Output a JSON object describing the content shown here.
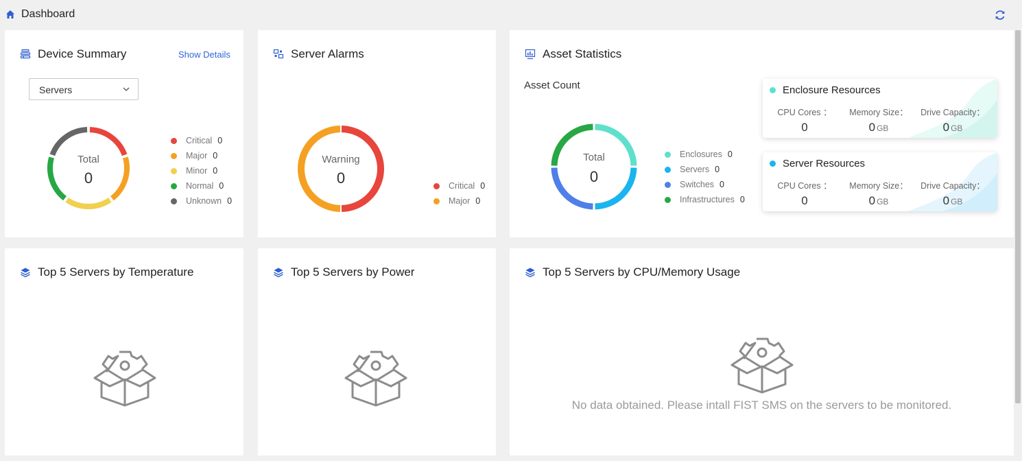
{
  "header": {
    "title": "Dashboard",
    "home_icon": "home-icon",
    "refresh_icon": "refresh-icon"
  },
  "device_summary": {
    "title": "Device Summary",
    "show_details": "Show Details",
    "selected": "Servers",
    "center_label": "Total",
    "center_value": "0",
    "legend": [
      {
        "label": "Critical",
        "count": "0",
        "color": "#e8453c"
      },
      {
        "label": "Major",
        "count": "0",
        "color": "#f5a023"
      },
      {
        "label": "Minor",
        "count": "0",
        "color": "#f0d04e"
      },
      {
        "label": "Normal",
        "count": "0",
        "color": "#28a745"
      },
      {
        "label": "Unknown",
        "count": "0",
        "color": "#666666"
      }
    ]
  },
  "server_alarms": {
    "title": "Server Alarms",
    "center_label": "Warning",
    "center_value": "0",
    "legend": [
      {
        "label": "Critical",
        "count": "0",
        "color": "#e8453c"
      },
      {
        "label": "Major",
        "count": "0",
        "color": "#f5a023"
      }
    ]
  },
  "asset_statistics": {
    "title": "Asset Statistics",
    "asset_count_label": "Asset Count",
    "center_label": "Total",
    "center_value": "0",
    "legend": [
      {
        "label": "Enclosures",
        "count": "0",
        "color": "#5ee0cc"
      },
      {
        "label": "Servers",
        "count": "0",
        "color": "#1ab4ef"
      },
      {
        "label": "Switches",
        "count": "0",
        "color": "#4f7fe8"
      },
      {
        "label": "Infrastructures",
        "count": "0",
        "color": "#28a745"
      }
    ],
    "enclosure": {
      "title": "Enclosure Resources",
      "dot_color": "#5ee0cc",
      "cpu_label": "CPU Cores ：",
      "cpu_value": "0",
      "mem_label": "Memory Size：",
      "mem_value": "0",
      "mem_unit": "GB",
      "drive_label": "Drive Capacity：",
      "drive_value": "0",
      "drive_unit": "GB"
    },
    "server": {
      "title": "Server Resources",
      "dot_color": "#1ab4ef",
      "cpu_label": "CPU Cores ：",
      "cpu_value": "0",
      "mem_label": "Memory Size：",
      "mem_value": "0",
      "mem_unit": "GB",
      "drive_label": "Drive Capacity：",
      "drive_value": "0",
      "drive_unit": "GB"
    }
  },
  "top_temperature": {
    "title": "Top 5 Servers by Temperature"
  },
  "top_power": {
    "title": "Top 5 Servers by Power"
  },
  "top_cpu_mem": {
    "title": "Top 5 Servers by CPU/Memory Usage",
    "empty_message": "No data obtained. Please intall FIST SMS on the servers to be monitored."
  },
  "colors": {
    "accent": "#2f66d8",
    "icon_blue": "#2f5fd0"
  }
}
